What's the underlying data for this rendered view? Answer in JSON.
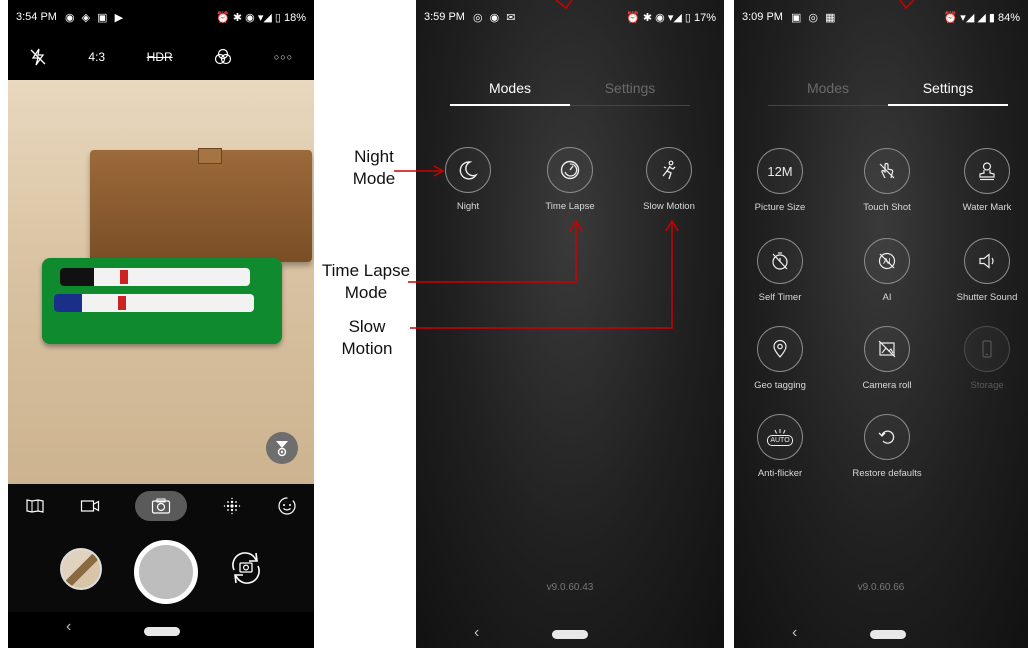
{
  "phone1": {
    "status": {
      "time": "3:54 PM",
      "right": "18%"
    },
    "topbar": {
      "ratio": "4:3",
      "hdr": "HDR",
      "more": "○○○"
    },
    "nav": {
      "back": "‹"
    }
  },
  "phone2": {
    "status": {
      "time": "3:59 PM",
      "right": "17%"
    },
    "tabs": {
      "modes": "Modes",
      "settings": "Settings"
    },
    "modes": [
      {
        "label": "Night",
        "icon": "moon-icon"
      },
      {
        "label": "Time Lapse",
        "icon": "timelapse-icon"
      },
      {
        "label": "Slow Motion",
        "icon": "running-person-icon"
      }
    ],
    "version": "v9.0.60.43",
    "nav": {
      "back": "‹"
    }
  },
  "phone3": {
    "status": {
      "time": "3:09 PM",
      "right": "84%"
    },
    "tabs": {
      "modes": "Modes",
      "settings": "Settings"
    },
    "settings": [
      {
        "label": "Picture Size",
        "icon_text": "12M",
        "icon": "picture-size-icon"
      },
      {
        "label": "Touch Shot",
        "icon": "touch-shot-icon"
      },
      {
        "label": "Water Mark",
        "icon": "water-mark-icon"
      },
      {
        "label": "Self Timer",
        "icon": "self-timer-icon"
      },
      {
        "label": "AI",
        "icon": "ai-off-icon"
      },
      {
        "label": "Shutter Sound",
        "icon": "speaker-icon"
      },
      {
        "label": "Geo tagging",
        "icon": "location-pin-icon"
      },
      {
        "label": "Camera roll",
        "icon": "camera-roll-off-icon"
      },
      {
        "label": "Storage",
        "icon": "phone-storage-icon",
        "disabled": true
      },
      {
        "label": "Anti-flicker",
        "icon_text": "AUTO",
        "icon": "anti-flicker-icon"
      },
      {
        "label": "Restore defaults",
        "icon": "restore-icon"
      }
    ],
    "version": "v9.0.60.66",
    "nav": {
      "back": "‹"
    }
  },
  "annotations": {
    "night": "Night Mode",
    "timelapse": "Time Lapse Mode",
    "slowmo": "Slow Motion"
  },
  "colors": {
    "arrow": "#cc0000",
    "camera_body": "#0f8a2e"
  }
}
